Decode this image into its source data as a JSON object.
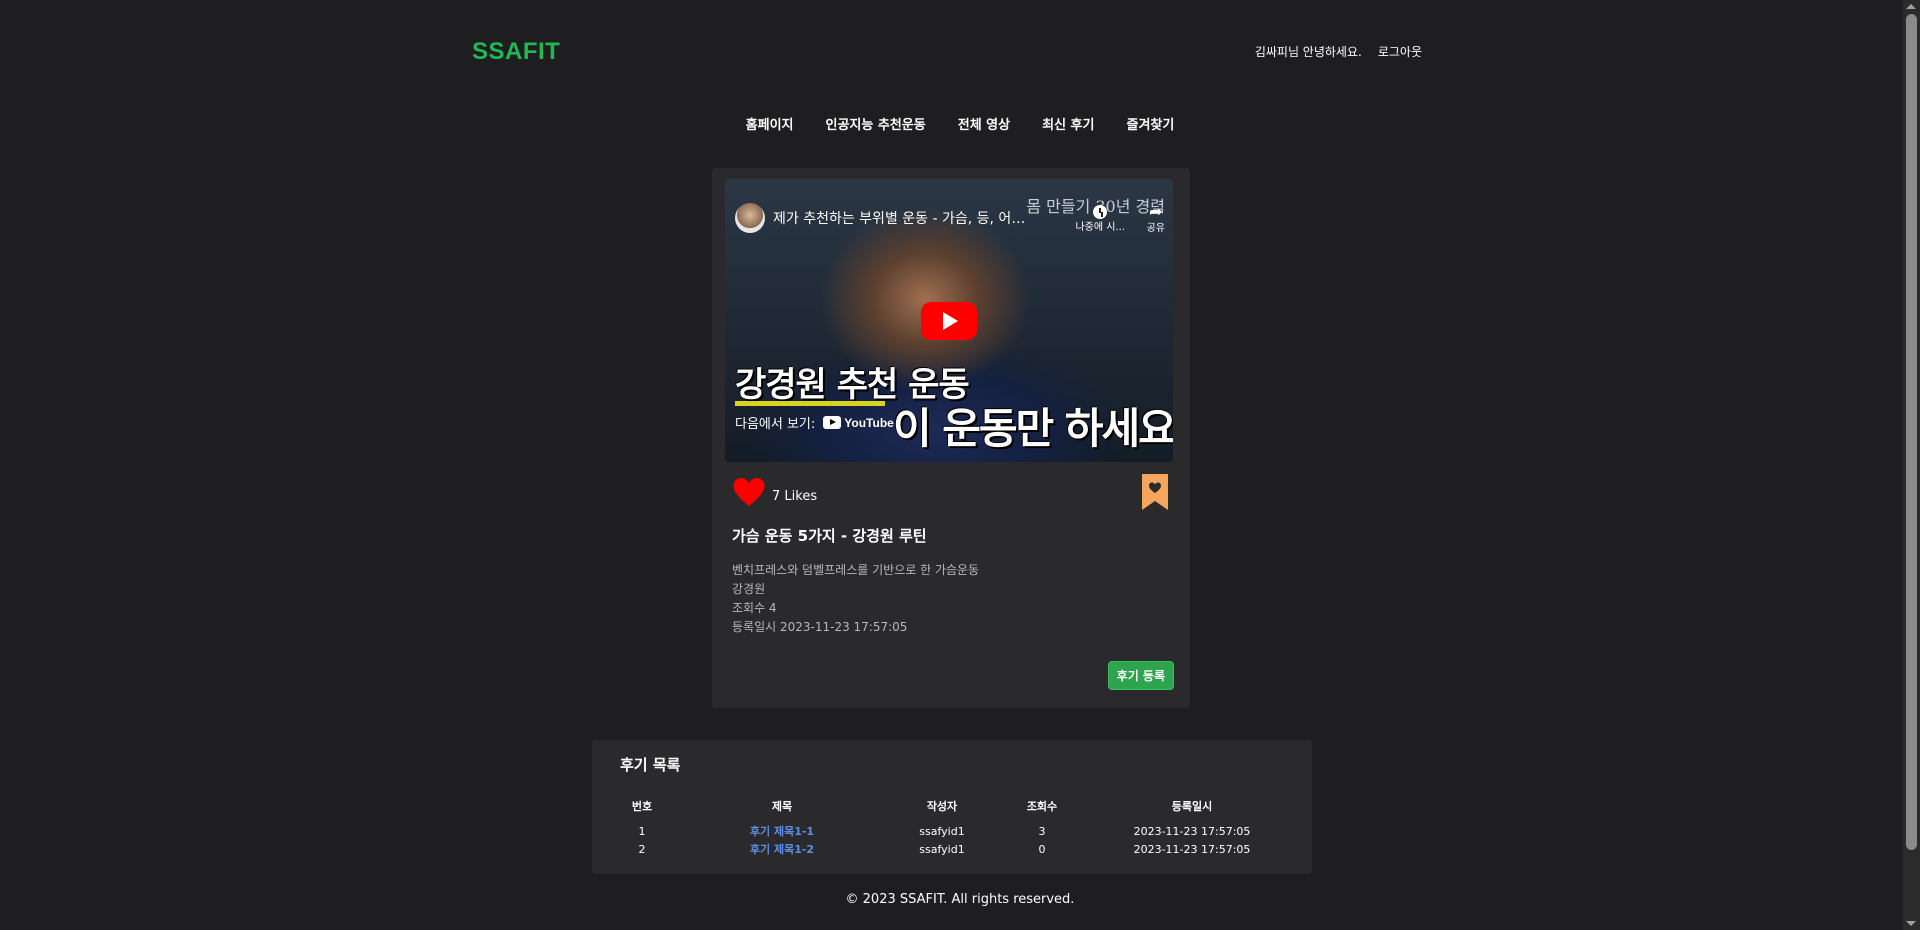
{
  "header": {
    "logo": "SSAFIT",
    "greeting": "김싸피님 안녕하세요.",
    "logout": "로그아웃"
  },
  "nav": [
    {
      "label": "홈페이지"
    },
    {
      "label": "인공지능 추천운동"
    },
    {
      "label": "전체 영상"
    },
    {
      "label": "최신 후기"
    },
    {
      "label": "즐겨찾기"
    }
  ],
  "video": {
    "embed_title": "제가 추천하는 부위별 운동 - 가슴, 등, 어깨, 하체",
    "watch_later_label": "나중에 시...",
    "share_label": "공유",
    "overlay_text": "몸 만들기 30년 경력",
    "thumbnail_line1": "강경원 추천 운동",
    "thumbnail_line2": "이 운동만 하세요",
    "watch_on": "다음에서 보기:",
    "youtube_brand": "YouTube",
    "likes": "7 Likes",
    "title": "가슴 운동 5가지 - 강경원 루틴",
    "description": "벤치프레스와 덤벨프레스를 기반으로 한 가슴운동",
    "channel": "강경원",
    "views": "조회수 4",
    "registered": "등록일시 2023-11-23 17:57:05",
    "review_button": "후기 등록",
    "heart_color": "#ff0000",
    "bookmark_color": "#f4a65c"
  },
  "reviews": {
    "title": "후기 목록",
    "columns": [
      "번호",
      "제목",
      "작성자",
      "조회수",
      "등록일시"
    ],
    "rows": [
      {
        "no": "1",
        "title": "후기 제목1-1",
        "author": "ssafyid1",
        "views": "3",
        "date": "2023-11-23 17:57:05"
      },
      {
        "no": "2",
        "title": "후기 제목1-2",
        "author": "ssafyid1",
        "views": "0",
        "date": "2023-11-23 17:57:05"
      }
    ]
  },
  "footer": "© 2023 SSAFIT. All rights reserved."
}
